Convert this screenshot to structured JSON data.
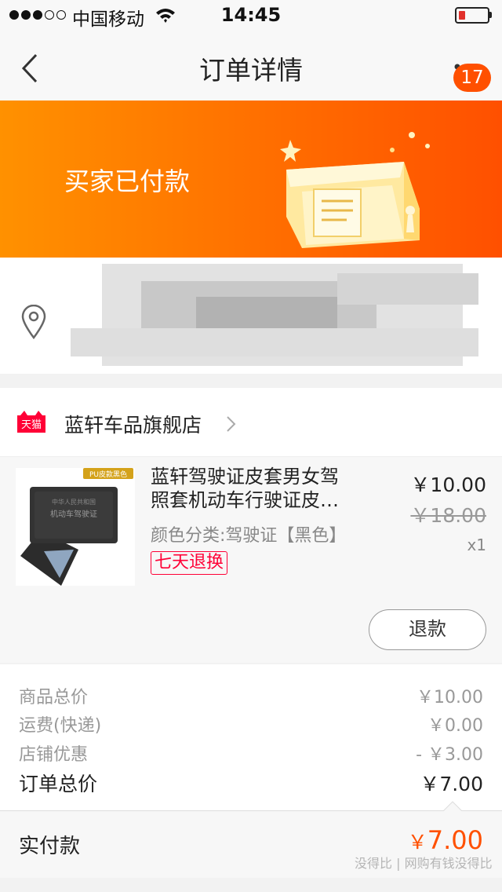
{
  "status_bar": {
    "carrier": "中国移动",
    "time": "14:45",
    "battery_color": "#e1302b"
  },
  "nav": {
    "title": "订单详情",
    "badge": "17"
  },
  "banner": {
    "status": "买家已付款",
    "gradient": [
      "#ff9100",
      "#ff5000"
    ]
  },
  "address": {
    "obscured": true
  },
  "store": {
    "badge_label": "天猫",
    "name": "蓝轩车品旗舰店"
  },
  "product": {
    "title_line1": "蓝轩驾驶证皮套男女驾",
    "title_line2": "照套机动车行驶证皮…",
    "sku": "颜色分类:驾驶证【黑色】",
    "tag": "七天退换",
    "price": "￥10.00",
    "original_price": "￥18.00",
    "quantity": "x1",
    "thumb_corner_label": "PU皮款黑色",
    "thumb_cover_line1": "中华人民共和国",
    "thumb_cover_line2": "机动车驾驶证",
    "refund_label": "退款"
  },
  "summary": {
    "rows": [
      {
        "label": "商品总价",
        "value": "￥10.00"
      },
      {
        "label": "运费(快递)",
        "value": "￥0.00"
      },
      {
        "label": "店铺优惠",
        "value": "- ￥3.00"
      }
    ],
    "total_label": "订单总价",
    "total_value": "￥7.00",
    "paid_label": "实付款",
    "paid_currency": "￥",
    "paid_amount": "7.00"
  },
  "watermark": "没得比 | 网购有钱没得比",
  "colors": {
    "accent": "#ff5000",
    "tmall_red": "#ff0036"
  }
}
